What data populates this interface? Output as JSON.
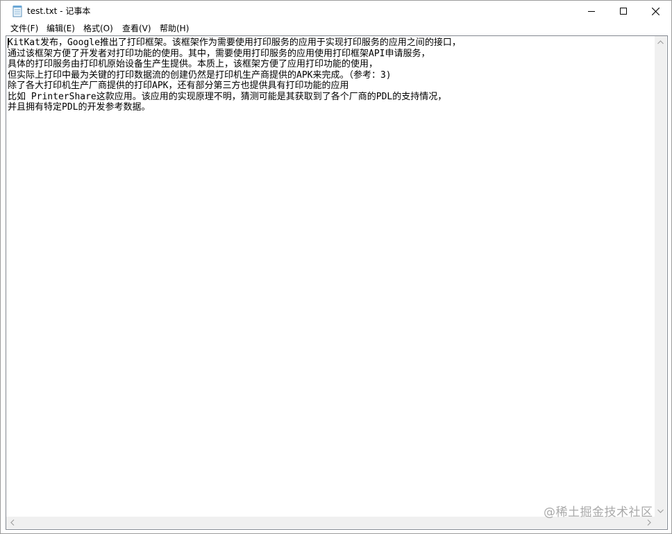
{
  "window": {
    "title": "test.txt - 记事本"
  },
  "menu": {
    "items": [
      {
        "label": "文件(F)"
      },
      {
        "label": "编辑(E)"
      },
      {
        "label": "格式(O)"
      },
      {
        "label": "查看(V)"
      },
      {
        "label": "帮助(H)"
      }
    ]
  },
  "editor": {
    "lines": [
      "KitKat发布，Google推出了打印框架。该框架作为需要使用打印服务的应用于实现打印服务的应用之间的接口，",
      "通过该框架方便了开发者对打印功能的使用。其中，需要使用打印服务的应用使用打印框架API申请服务，",
      "具体的打印服务由打印机原始设备生产生提供。本质上，该框架方便了应用打印功能的使用，",
      "但实际上打印中最为关键的打印数据流的创建仍然是打印机生产商提供的APK来完成。（参考：3)",
      "除了各大打印机生产厂商提供的打印APK，还有部分第三方也提供具有打印功能的应用",
      "比如 PrinterShare这款应用。该应用的实现原理不明，猜测可能是其获取到了各个厂商的PDL的支持情况，",
      "并且拥有特定PDL的开发参考数据。"
    ]
  },
  "watermark": {
    "text": "@稀土掘金技术社区"
  },
  "colors": {
    "scrollbar_bg": "#f0f0f0",
    "border": "#828790",
    "watermark": "#a9a9a9"
  }
}
